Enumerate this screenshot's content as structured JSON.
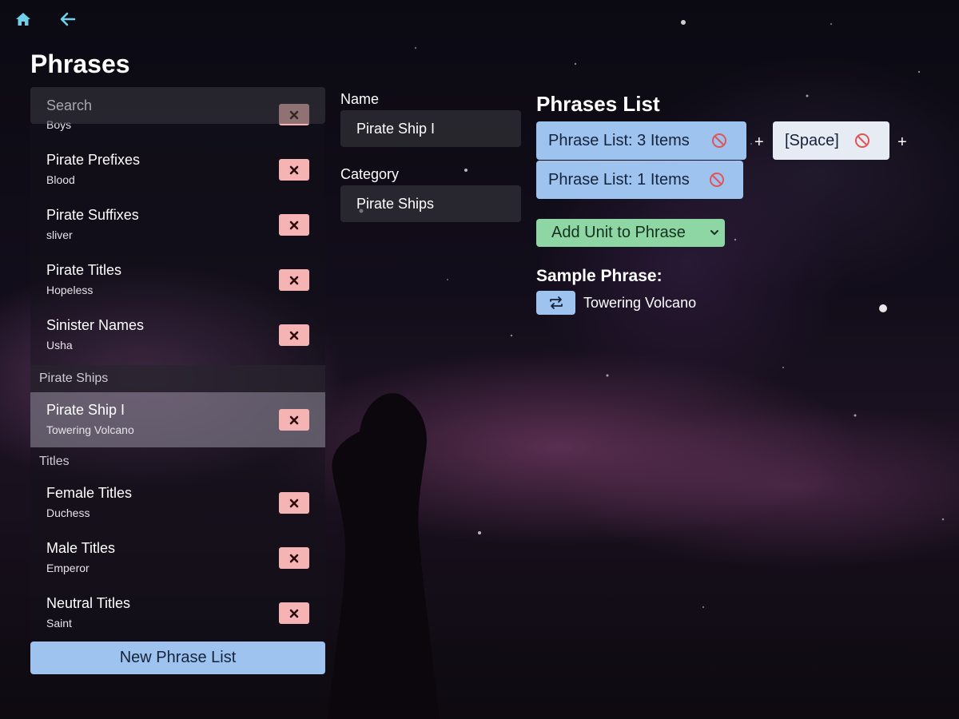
{
  "page_title": "Phrases",
  "sidebar": {
    "search_placeholder": "Search",
    "partial_item_subtitle": "Boys",
    "items_group1": [
      {
        "title": "Pirate Prefixes",
        "subtitle": "Blood"
      },
      {
        "title": "Pirate Suffixes",
        "subtitle": "sliver"
      },
      {
        "title": "Pirate Titles",
        "subtitle": "Hopeless"
      },
      {
        "title": "Sinister Names",
        "subtitle": "Usha"
      }
    ],
    "section_pirate_ships": "Pirate Ships",
    "selected_item": {
      "title": "Pirate Ship I",
      "subtitle": "Towering Volcano"
    },
    "section_titles": "Titles",
    "items_group2": [
      {
        "title": "Female Titles",
        "subtitle": "Duchess"
      },
      {
        "title": "Male Titles",
        "subtitle": "Emperor"
      },
      {
        "title": "Neutral Titles",
        "subtitle": "Saint"
      }
    ],
    "new_button": "New Phrase List"
  },
  "form": {
    "name_label": "Name",
    "name_value": "Pirate Ship I",
    "category_label": "Category",
    "category_value": "Pirate Ships"
  },
  "phrases": {
    "heading": "Phrases List",
    "units": [
      "Phrase List: 3 Items",
      "[Space]",
      "Phrase List: 1 Items"
    ],
    "plus": "+",
    "add_unit": "Add Unit to Phrase",
    "sample_heading": "Sample Phrase:",
    "sample_text": "Towering Volcano"
  },
  "colors": {
    "accent_blue": "#9ec3ef",
    "delete_red": "#f6b3b3",
    "add_green": "#8ed6a4",
    "icon_teal": "#6fd0e8"
  }
}
